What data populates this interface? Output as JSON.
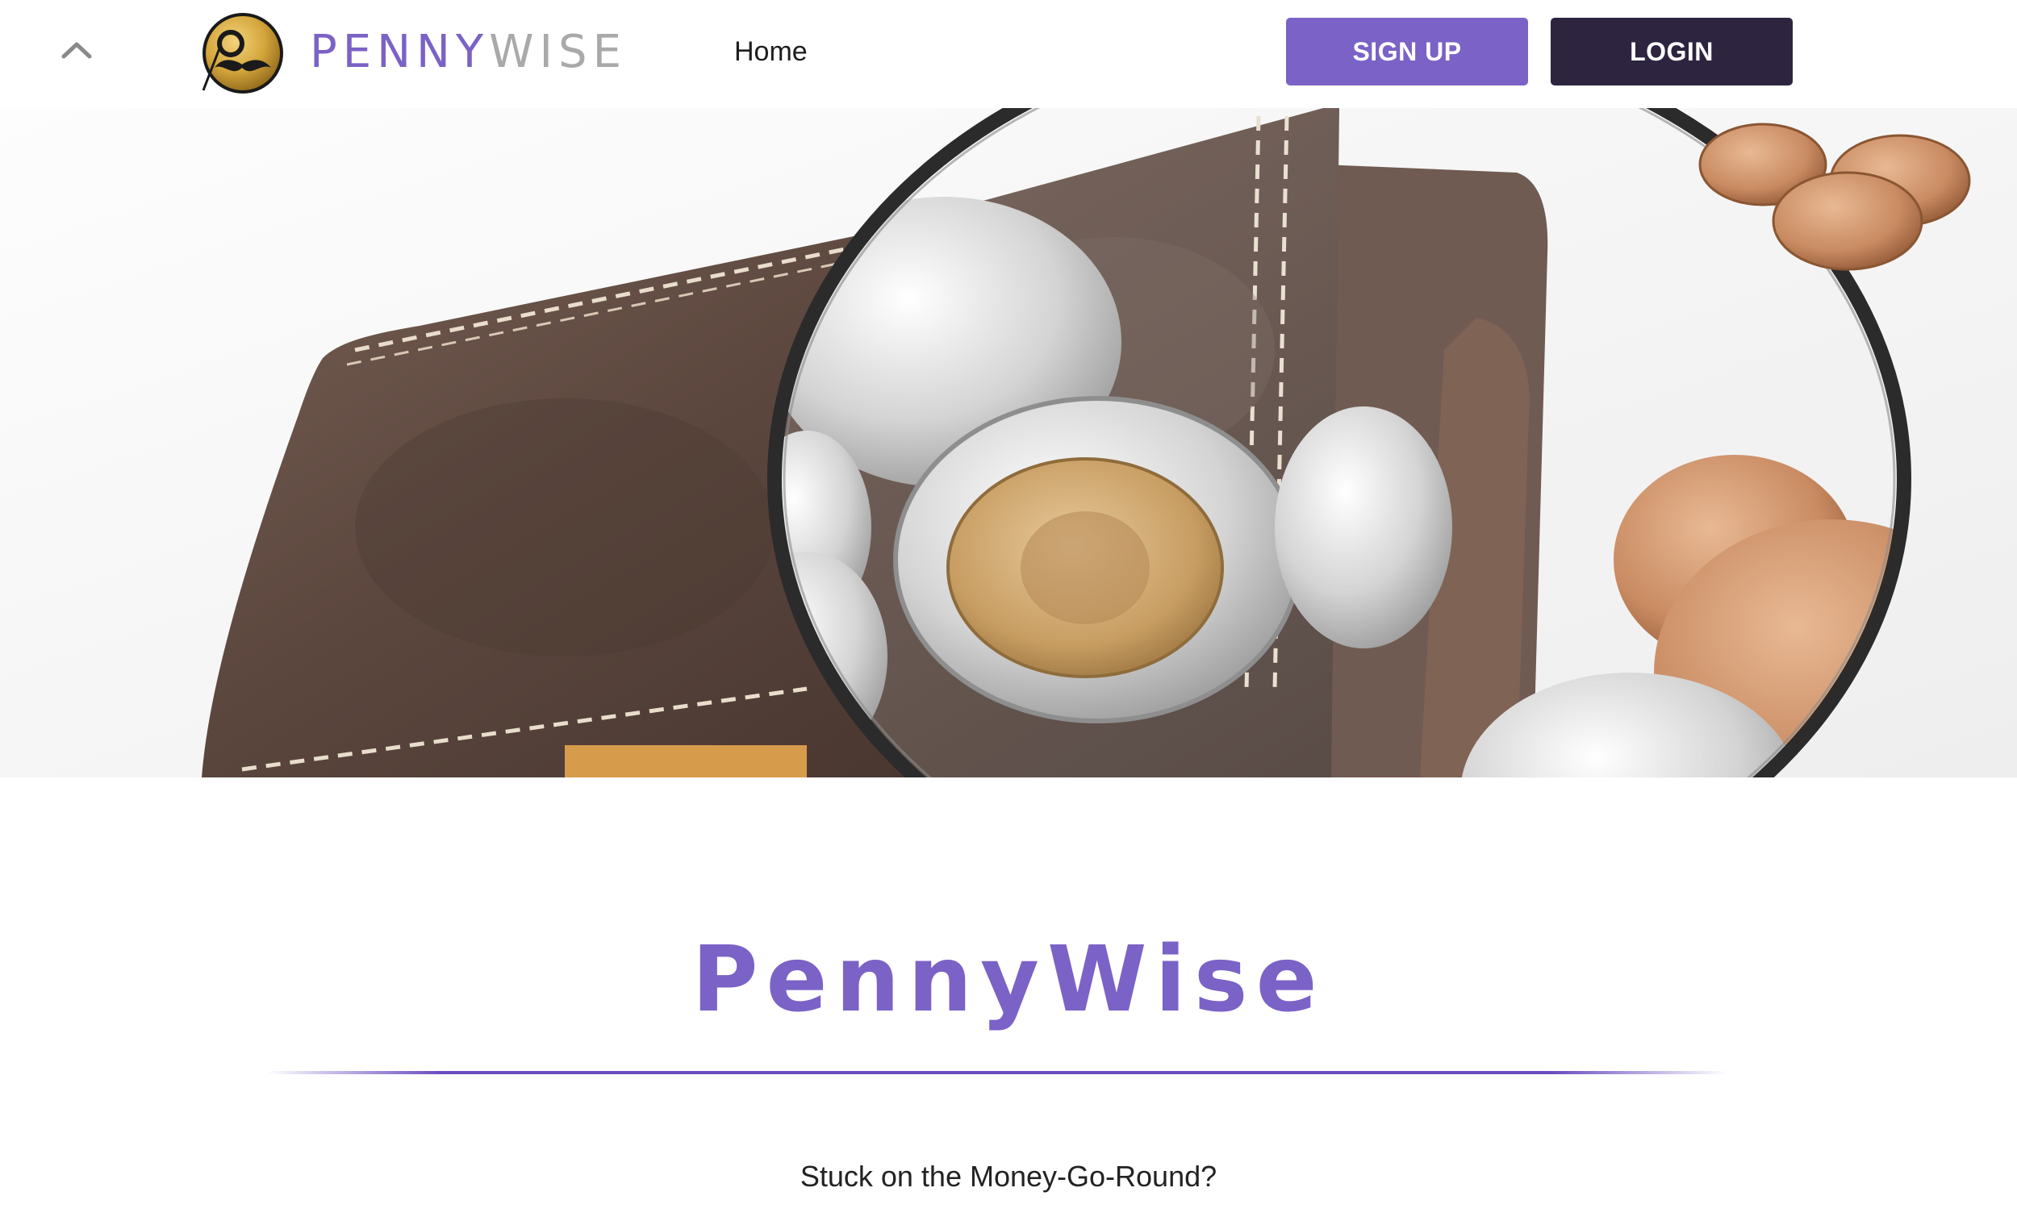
{
  "nav": {
    "logo_penny": "PENNY",
    "logo_wise": "WISE",
    "home_label": "Home",
    "signup_label": "SIGN UP",
    "login_label": "LOGIN"
  },
  "main": {
    "title": "PennyWise",
    "tagline": "Stuck on the Money-Go-Round?"
  },
  "colors": {
    "brand_purple": "#7b62c6",
    "logo_grey": "#a9a9a9",
    "login_dark": "#2d2440"
  },
  "icons": {
    "collapse": "chevron-up-icon",
    "logo": "monocle-mustache-logo-icon"
  }
}
